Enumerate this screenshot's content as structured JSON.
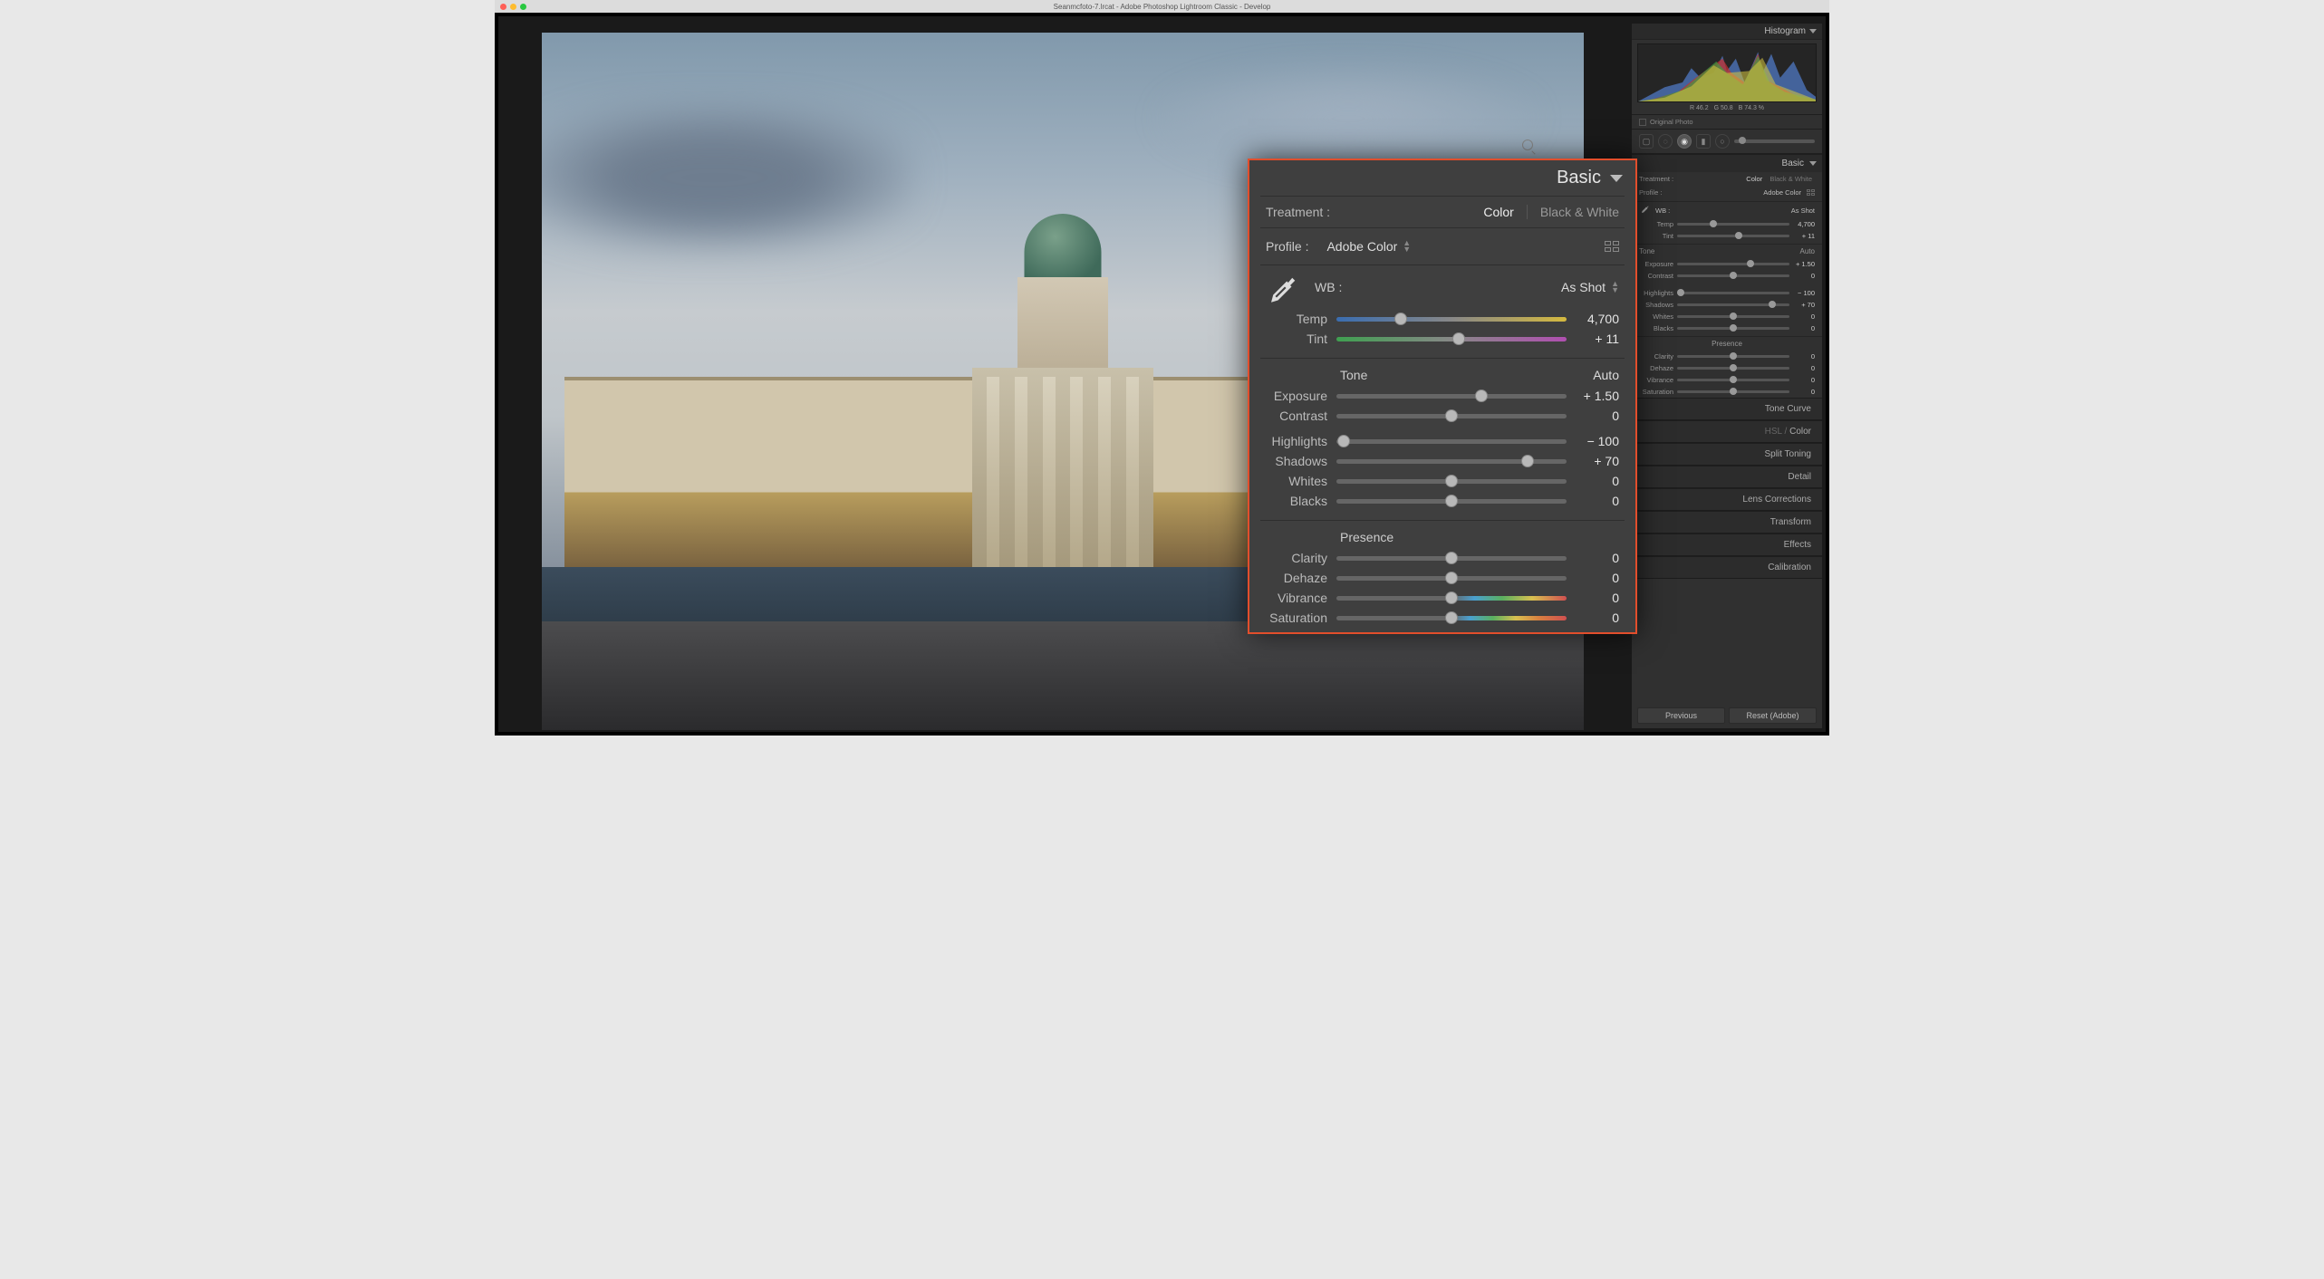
{
  "window": {
    "title": "Seanmcfoto-7.lrcat - Adobe Photoshop Lightroom Classic - Develop"
  },
  "histogram": {
    "title": "Histogram",
    "r": "R  46.2",
    "g": "G  50.8",
    "b": "B  74.3 %",
    "original_photo_label": "Original Photo"
  },
  "side_basic": {
    "title": "Basic",
    "treatment_label": "Treatment :",
    "color": "Color",
    "bw": "Black & White",
    "profile_label": "Profile :",
    "profile_value": "Adobe Color",
    "wb_label": "WB :",
    "wb_value": "As Shot",
    "sliders": {
      "temp": {
        "label": "Temp",
        "value": "4,700",
        "pos": 32
      },
      "tint": {
        "label": "Tint",
        "value": "+ 11",
        "pos": 55
      },
      "tone_label": "Tone",
      "auto_label": "Auto",
      "exposure": {
        "label": "Exposure",
        "value": "+ 1.50",
        "pos": 65
      },
      "contrast": {
        "label": "Contrast",
        "value": "0",
        "pos": 50
      },
      "highlights": {
        "label": "Highlights",
        "value": "− 100",
        "pos": 3
      },
      "shadows": {
        "label": "Shadows",
        "value": "+ 70",
        "pos": 85
      },
      "whites": {
        "label": "Whites",
        "value": "0",
        "pos": 50
      },
      "blacks": {
        "label": "Blacks",
        "value": "0",
        "pos": 50
      },
      "presence_label": "Presence",
      "clarity": {
        "label": "Clarity",
        "value": "0",
        "pos": 50
      },
      "dehaze": {
        "label": "Dehaze",
        "value": "0",
        "pos": 50
      },
      "vibrance": {
        "label": "Vibrance",
        "value": "0",
        "pos": 50
      },
      "saturation": {
        "label": "Saturation",
        "value": "0",
        "pos": 50
      }
    }
  },
  "popout": {
    "title": "Basic",
    "treatment_label": "Treatment :",
    "color": "Color",
    "bw": "Black & White",
    "profile_label": "Profile :",
    "profile_value": "Adobe Color",
    "wb_label": "WB :",
    "wb_value": "As Shot",
    "tone_label": "Tone",
    "auto_label": "Auto",
    "presence_label": "Presence",
    "sliders": {
      "temp": {
        "label": "Temp",
        "value": "4,700",
        "pos": 28
      },
      "tint": {
        "label": "Tint",
        "value": "+ 11",
        "pos": 53
      },
      "exposure": {
        "label": "Exposure",
        "value": "+ 1.50",
        "pos": 63
      },
      "contrast": {
        "label": "Contrast",
        "value": "0",
        "pos": 50
      },
      "highlights": {
        "label": "Highlights",
        "value": "− 100",
        "pos": 3
      },
      "shadows": {
        "label": "Shadows",
        "value": "+ 70",
        "pos": 83
      },
      "whites": {
        "label": "Whites",
        "value": "0",
        "pos": 50
      },
      "blacks": {
        "label": "Blacks",
        "value": "0",
        "pos": 50
      },
      "clarity": {
        "label": "Clarity",
        "value": "0",
        "pos": 50
      },
      "dehaze": {
        "label": "Dehaze",
        "value": "0",
        "pos": 50
      },
      "vibrance": {
        "label": "Vibrance",
        "value": "0",
        "pos": 50
      },
      "saturation": {
        "label": "Saturation",
        "value": "0",
        "pos": 50
      }
    }
  },
  "collapsed_panels": {
    "tone_curve": "Tone Curve",
    "hsl_pre": "HSL",
    "hsl_sep": " / ",
    "hsl_post": "Color",
    "split_toning": "Split Toning",
    "detail": "Detail",
    "lens": "Lens Corrections",
    "transform": "Transform",
    "effects": "Effects",
    "calibration": "Calibration"
  },
  "footer": {
    "previous": "Previous",
    "reset": "Reset (Adobe)"
  }
}
